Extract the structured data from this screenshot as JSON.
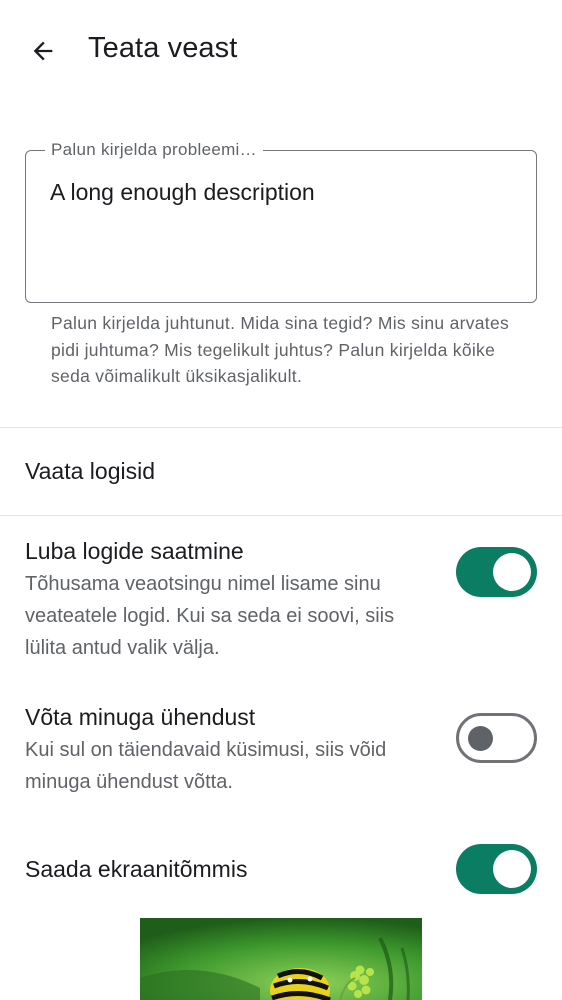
{
  "appbar": {
    "back_icon": "arrow-back-icon",
    "title": "Teata veast"
  },
  "description": {
    "label": "Palun kirjelda probleemi…",
    "value": "A long enough description",
    "helper": "Palun kirjelda juhtunut. Mida sina tegid? Mis sinu arvates pidi juhtuma? Mis tegelikult juhtus? Palun kirjelda kõike seda võimalikult üksikasjalikult."
  },
  "logs": {
    "view_label": "Vaata logisid"
  },
  "prefs": {
    "send_logs": {
      "title": "Luba logide saatmine",
      "summary": "Tõhusama veaotsingu nimel lisame sinu veateatele logid. Kui sa seda ei soovi, siis lülita antud valik välja.",
      "enabled": true
    },
    "contact_me": {
      "title": "Võta minuga ühendust",
      "summary": "Kui sul on täiendavaid küsimusi, siis võid minuga ühendust võtta.",
      "enabled": false
    },
    "send_screenshot": {
      "title": "Saada ekraanitõmmis",
      "enabled": true
    }
  },
  "colors": {
    "accent": "#0a7d62",
    "outline": "#79747e",
    "secondary_text": "#5f6368"
  }
}
